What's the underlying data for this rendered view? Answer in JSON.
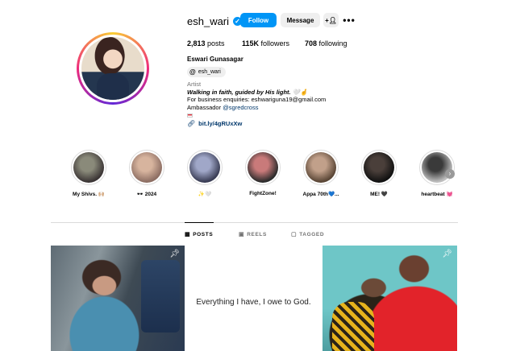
{
  "profile": {
    "username": "esh_wari",
    "verified_icon": "verified-check-icon",
    "follow_label": "Follow",
    "message_label": "Message",
    "add_user_glyph": "+R",
    "more_glyph": "•••",
    "stats": {
      "posts_value": "2,813",
      "posts_label": "posts",
      "followers_value": "115K",
      "followers_label": "followers",
      "following_value": "708",
      "following_label": "following"
    },
    "full_name": "Eswari Gunasagar",
    "threads_handle": "esh_wari",
    "category": "Artist",
    "bio_line1": "Walking in faith, guided by His light. 🤍🤞",
    "bio_line2": "For business enquiries: eshwariguna19@gmail.com",
    "bio_line3_prefix": "Ambassador ",
    "bio_line3_mention": "@sgredcross",
    "link": "bit.ly/4gRUxXw"
  },
  "highlights": [
    {
      "label": "My Shivs. 🙌🏼",
      "colors": [
        "#3b3535",
        "#8a8a7a"
      ]
    },
    {
      "label": "🕶️ 2024",
      "colors": [
        "#8d6e63",
        "#d7b49e"
      ]
    },
    {
      "label": "✨🤍",
      "colors": [
        "#3a3d55",
        "#a0a7c8"
      ]
    },
    {
      "label": "FightZone!",
      "colors": [
        "#2b2b2b",
        "#c97a7a"
      ]
    },
    {
      "label": "Appa 70th💙...",
      "colors": [
        "#5a4636",
        "#c1a08a"
      ]
    },
    {
      "label": "ME! 🖤",
      "colors": [
        "#111111",
        "#4a3f3a"
      ]
    },
    {
      "label": "heartbeat 💓",
      "colors": [
        "#bfbfbf",
        "#3a3a3a"
      ]
    }
  ],
  "tabs": {
    "posts": "POSTS",
    "reels": "REELS",
    "tagged": "TAGGED"
  },
  "posts": {
    "quote_text": "Everything I have, I owe to God."
  },
  "colors": {
    "accent": "#0095f6",
    "link": "#00376b",
    "muted": "#737373"
  }
}
